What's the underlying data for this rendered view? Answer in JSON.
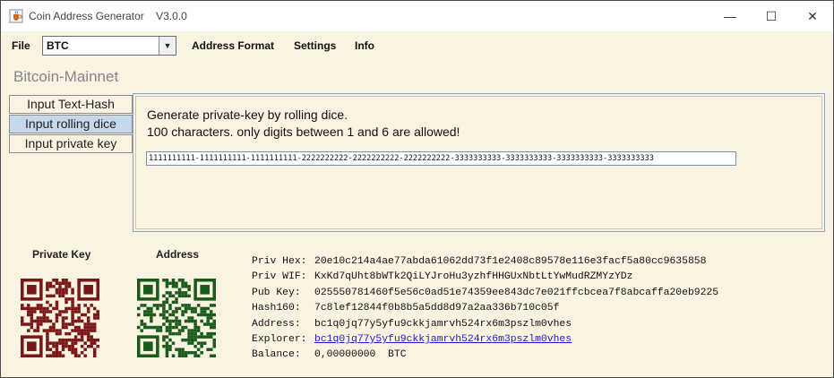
{
  "window": {
    "app_name": "Coin Address Generator",
    "version": "V3.0.0",
    "controls": {
      "minimize": "—",
      "maximize": "☐",
      "close": "✕"
    }
  },
  "menubar": {
    "file": "File",
    "coin_selected": "BTC",
    "address_format": "Address Format",
    "settings": "Settings",
    "info": "Info"
  },
  "network": "Bitcoin-Mainnet",
  "tabs": [
    {
      "label": "Input Text-Hash",
      "active": false
    },
    {
      "label": "Input rolling dice",
      "active": true
    },
    {
      "label": "Input private key",
      "active": false
    }
  ],
  "dice_panel": {
    "line1": "Generate private-key by rolling dice.",
    "line2": "100 characters. only digits between 1 and 6 are allowed!",
    "input_value": "1111111111-1111111111-1111111111-2222222222-2222222222-2222222222-3333333333-3333333333-3333333333-3333333333"
  },
  "qr": {
    "private_key_label": "Private Key",
    "address_label": "Address",
    "private_key_color": "#7a1616",
    "address_color": "#1a5a1a"
  },
  "key_info": {
    "priv_hex_label": "Priv Hex:",
    "priv_hex": "20e10c214a4ae77abda61062dd73f1e2408c89578e116e3facf5a80cc9635858",
    "priv_wif_label": "Priv WIF:",
    "priv_wif": "KxKd7qUht8bWTk2QiLYJroHu3yzhfHHGUxNbtLtYwMudRZMYzYDz",
    "pub_key_label": "Pub Key:",
    "pub_key": "025550781460f5e56c0ad51e74359ee843dc7e021ffcbcea7f8abcaffa20eb9225",
    "hash160_label": "Hash160:",
    "hash160": "7c8lef12844f0b8b5a5dd8d97a2aa336b710c05f",
    "address_label": "Address:",
    "address": "bc1q0jq77y5yfu9ckkjamrvh524rx6m3pszlm0vhes",
    "explorer_label": "Explorer:",
    "explorer": "bc1q0jq77y5yfu9ckkjamrvh524rx6m3pszlm0vhes",
    "balance_label": "Balance:",
    "balance": "0,00000000",
    "balance_unit": "BTC"
  }
}
